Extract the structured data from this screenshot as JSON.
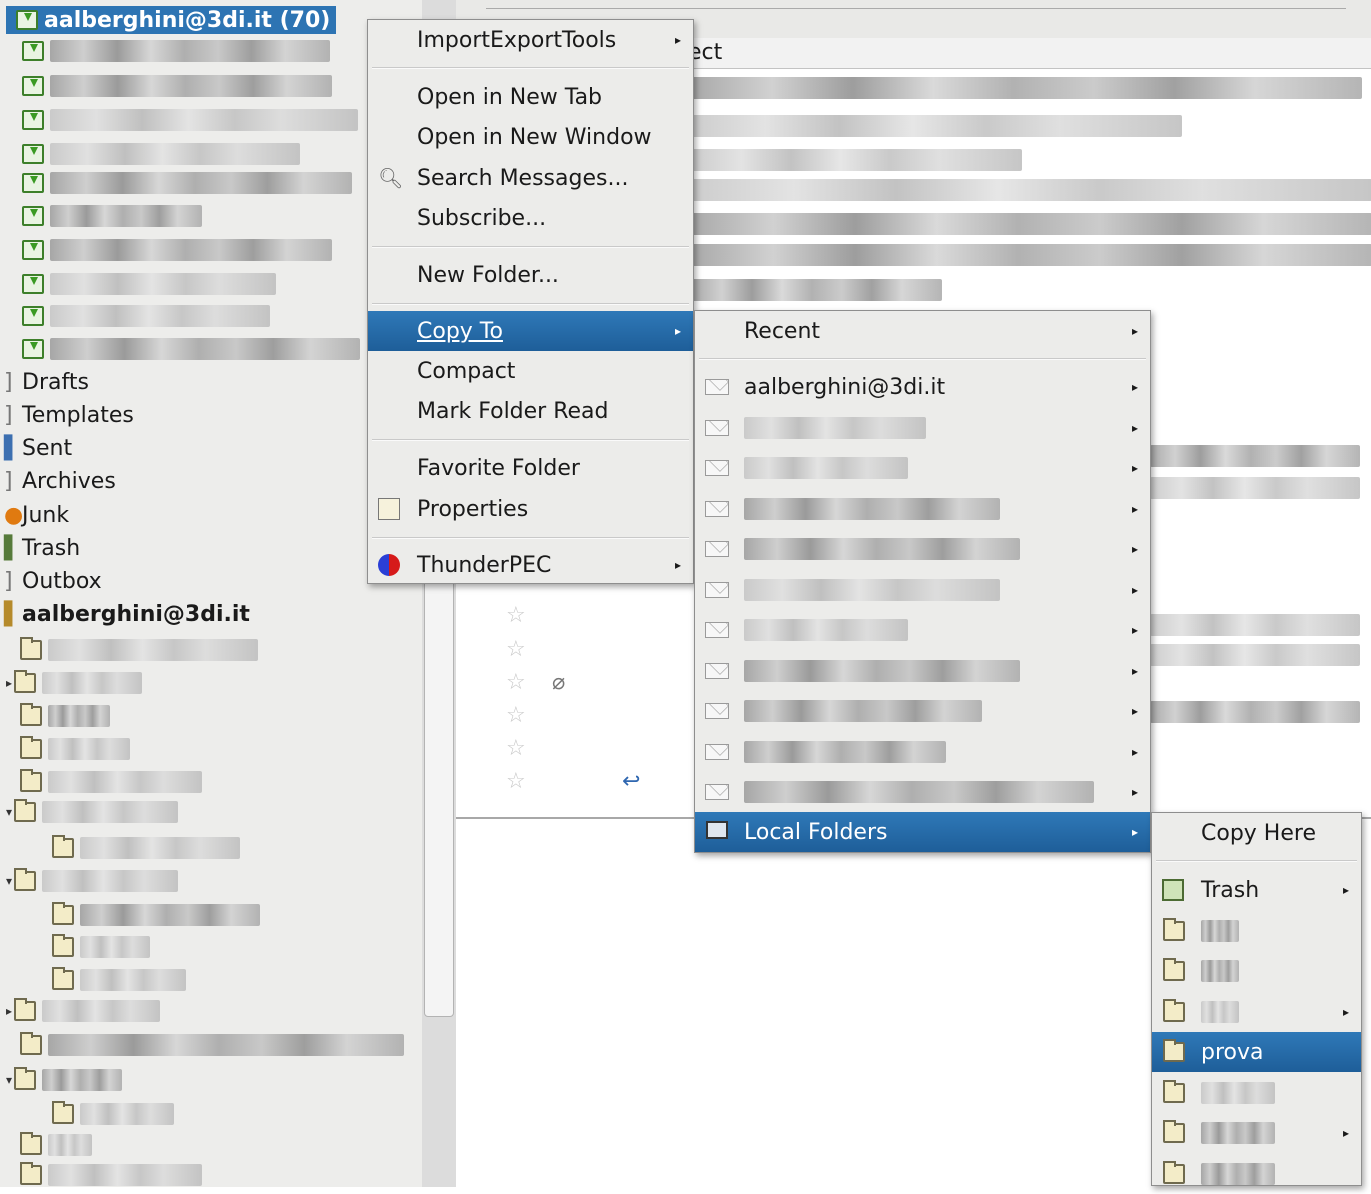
{
  "folder_pane": {
    "account_top": "aalberghini@3di.it (70)",
    "special_folders": [
      "Drafts",
      "Templates",
      "Sent",
      "Archives",
      "Junk",
      "Trash",
      "Outbox"
    ],
    "account_bottom": "aalberghini@3di.it"
  },
  "message_pane": {
    "header_text": "ect"
  },
  "context_menu": {
    "items": {
      "import_export": "ImportExportTools",
      "open_tab": "Open in New Tab",
      "open_window": "Open in New Window",
      "search": "Search Messages...",
      "subscribe": "Subscribe...",
      "new_folder": "New Folder...",
      "copy_to": "Copy To",
      "compact": "Compact",
      "mark_read": "Mark Folder Read",
      "favorite": "Favorite Folder",
      "properties": "Properties",
      "thunderpec": "ThunderPEC"
    }
  },
  "copy_to_menu": {
    "recent": "Recent",
    "account": "aalberghini@3di.it",
    "local_folders": "Local Folders"
  },
  "local_folders_menu": {
    "copy_here": "Copy Here",
    "trash": "Trash",
    "prova": "prova"
  },
  "colors": {
    "selection": "#2d74b3",
    "menu_bg": "#ececea"
  }
}
